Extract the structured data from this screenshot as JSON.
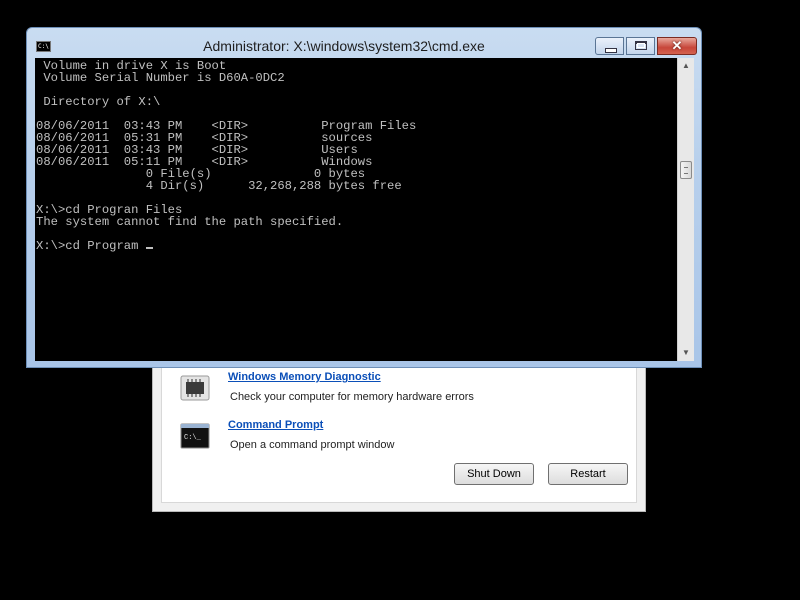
{
  "window": {
    "title": "Administrator: X:\\windows\\system32\\cmd.exe",
    "icon_text": "C:\\."
  },
  "console_lines": [
    " Volume in drive X is Boot",
    " Volume Serial Number is D60A-0DC2",
    "",
    " Directory of X:\\",
    "",
    "08/06/2011  03:43 PM    <DIR>          Program Files",
    "08/06/2011  05:31 PM    <DIR>          sources",
    "08/06/2011  03:43 PM    <DIR>          Users",
    "08/06/2011  05:11 PM    <DIR>          Windows",
    "               0 File(s)              0 bytes",
    "               4 Dir(s)      32,268,288 bytes free",
    "",
    "X:\\>cd Progran Files",
    "The system cannot find the path specified.",
    "",
    "X:\\>cd Program "
  ],
  "recovery": {
    "tools": [
      {
        "name": "Windows Memory Diagnostic",
        "description": "Check your computer for memory hardware errors",
        "icon": "memory-chip-icon"
      },
      {
        "name": "Command Prompt",
        "description": "Open a command prompt window",
        "icon": "command-prompt-icon",
        "icon_text": "C:\\_"
      }
    ],
    "shutdown_label": "Shut Down",
    "restart_label": "Restart"
  },
  "scrollbar": {
    "up_glyph": "▲",
    "down_glyph": "▼"
  },
  "colors": {
    "console_bg": "#000000",
    "console_text": "#c0c0c0",
    "link": "#0b4fb8",
    "close_button": "#c7463a"
  }
}
